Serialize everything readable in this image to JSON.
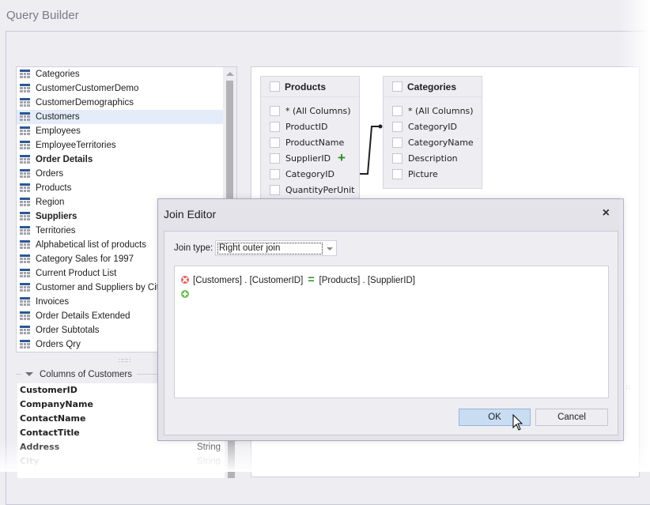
{
  "window": {
    "title": "Query Builder"
  },
  "tables": {
    "items": [
      {
        "label": "Categories",
        "bold": false,
        "selected": false
      },
      {
        "label": "CustomerCustomerDemo",
        "bold": false,
        "selected": false
      },
      {
        "label": "CustomerDemographics",
        "bold": false,
        "selected": false
      },
      {
        "label": "Customers",
        "bold": false,
        "selected": true
      },
      {
        "label": "Employees",
        "bold": false,
        "selected": false
      },
      {
        "label": "EmployeeTerritories",
        "bold": false,
        "selected": false
      },
      {
        "label": "Order Details",
        "bold": true,
        "selected": false
      },
      {
        "label": "Orders",
        "bold": false,
        "selected": false
      },
      {
        "label": "Products",
        "bold": false,
        "selected": false
      },
      {
        "label": "Region",
        "bold": false,
        "selected": false
      },
      {
        "label": "Suppliers",
        "bold": true,
        "selected": false
      },
      {
        "label": "Territories",
        "bold": false,
        "selected": false
      },
      {
        "label": "Alphabetical list of products",
        "bold": false,
        "selected": false
      },
      {
        "label": "Category Sales for 1997",
        "bold": false,
        "selected": false
      },
      {
        "label": "Current Product List",
        "bold": false,
        "selected": false
      },
      {
        "label": "Customer and Suppliers by City",
        "bold": false,
        "selected": false
      },
      {
        "label": "Invoices",
        "bold": false,
        "selected": false
      },
      {
        "label": "Order Details Extended",
        "bold": false,
        "selected": false
      },
      {
        "label": "Order Subtotals",
        "bold": false,
        "selected": false
      },
      {
        "label": "Orders Qry",
        "bold": false,
        "selected": false
      }
    ],
    "icon": "table-icon"
  },
  "columns": {
    "title": "Columns of Customers",
    "rows": [
      {
        "name": "CustomerID",
        "type": ""
      },
      {
        "name": "CompanyName",
        "type": ""
      },
      {
        "name": "ContactName",
        "type": ""
      },
      {
        "name": "ContactTitle",
        "type": ""
      },
      {
        "name": "Address",
        "type": "String"
      },
      {
        "name": "City",
        "type": "String"
      }
    ]
  },
  "diagram": {
    "products": {
      "title": "Products",
      "fields": [
        "* (All Columns)",
        "ProductID",
        "ProductName",
        "SupplierID",
        "CategoryID",
        "QuantityPerUnit"
      ]
    },
    "categories": {
      "title": "Categories",
      "fields": [
        "* (All Columns)",
        "CategoryID",
        "CategoryName",
        "Description",
        "Picture"
      ]
    },
    "relation": {
      "from": "Products.CategoryID",
      "to": "Categories.CategoryID"
    }
  },
  "join_editor": {
    "title": "Join Editor",
    "close_label": "×",
    "join_type_label": "Join type:",
    "join_type_value": "Right outer join",
    "condition": {
      "left": "[Customers] . [CustomerID]",
      "operator": "=",
      "right": "[Products] . [SupplierID]"
    },
    "ok_label": "OK",
    "cancel_label": "Cancel"
  },
  "colors": {
    "accent": "#2b5797",
    "selected_row": "#e3ecf8",
    "ok_button": "#c8dcf2",
    "operator": "#2e8b2e",
    "remove": "#e06060",
    "add": "#6fbf5a"
  }
}
